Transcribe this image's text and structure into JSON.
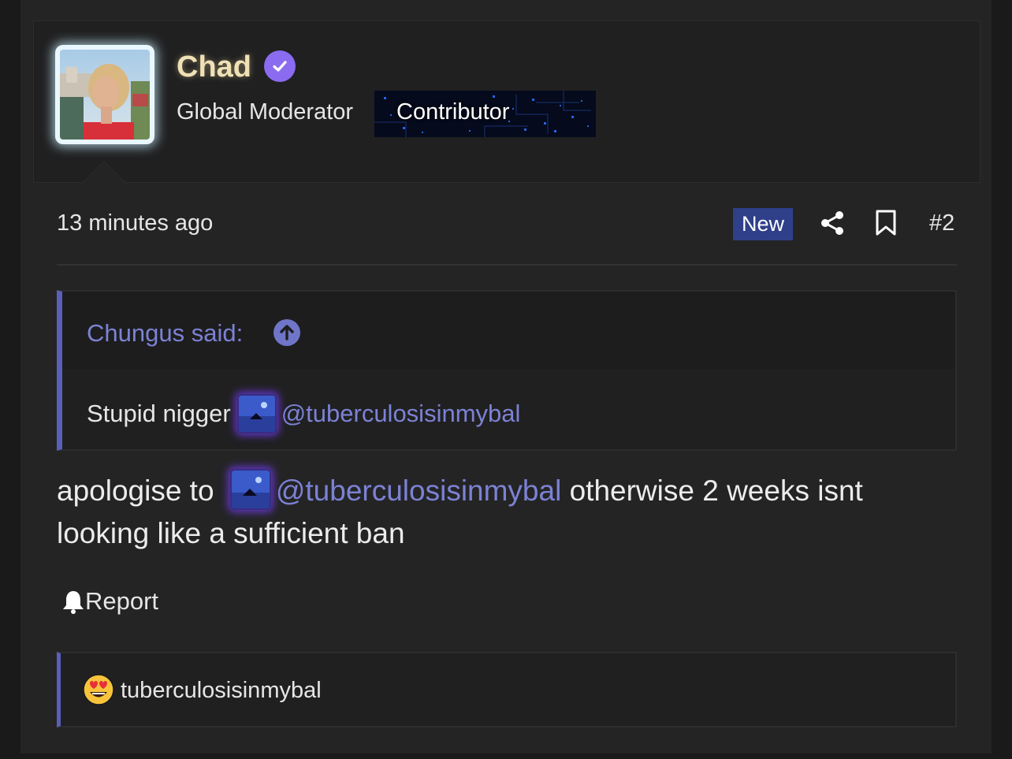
{
  "author": {
    "name": "Chad",
    "verified_icon": "verified-check-icon",
    "role": "Global Moderator",
    "banner_label": "Contributor"
  },
  "post": {
    "time": "13 minutes ago",
    "badge": "New",
    "share_icon": "share-icon",
    "bookmark_icon": "bookmark-icon",
    "number": "#2",
    "body_before": "apologise to ",
    "body_mention": "@tuberculosisinmybal",
    "body_after": " otherwise 2 weeks isnt looking like a sufficient ban"
  },
  "quote": {
    "author_label": "Chungus said:",
    "up_icon": "arrow-up-circle-icon",
    "text": "Stupid nigger",
    "mention": "@tuberculosisinmybal"
  },
  "actions": {
    "report_icon": "bell-icon",
    "report_label": "Report"
  },
  "reactions": {
    "emoji_icon": "heart-eyes-emoji-icon",
    "users": "tuberculosisinmybal"
  },
  "colors": {
    "accent": "#5a5fb8",
    "mention": "#7c82d4",
    "new_badge": "#2f3f8a",
    "verified": "#8b6cf0"
  }
}
